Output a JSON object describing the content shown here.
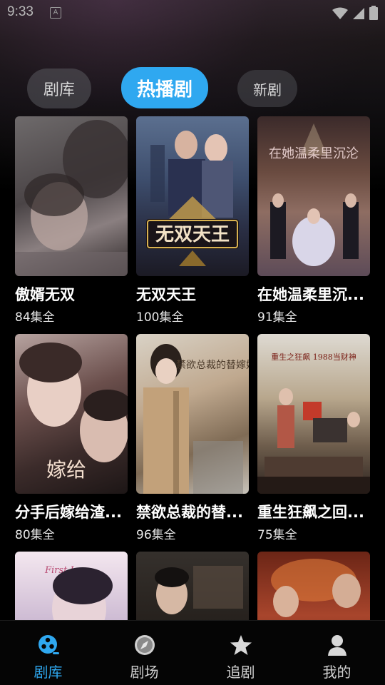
{
  "status_bar": {
    "time": "9:33",
    "notification_icon": "A"
  },
  "tabs": [
    {
      "label": "剧库"
    },
    {
      "label": "热播剧"
    },
    {
      "label": "新剧"
    }
  ],
  "dramas": [
    {
      "title": "傲婿无双",
      "episodes": "84集全"
    },
    {
      "title": "无双天王",
      "episodes": "100集全"
    },
    {
      "title": "在她温柔里沉...",
      "episodes": "91集全"
    },
    {
      "title": "分手后嫁给渣...",
      "episodes": "80集全"
    },
    {
      "title": "禁欲总裁的替...",
      "episodes": "96集全"
    },
    {
      "title": "重生狂飙之回...",
      "episodes": "75集全"
    },
    {
      "title": "",
      "episodes": ""
    },
    {
      "title": "",
      "episodes": ""
    },
    {
      "title": "",
      "episodes": ""
    }
  ],
  "poster_text": {
    "p2": "无双天王",
    "p3": "在她温柔里沉沦",
    "p4": "嫁给",
    "p5": "禁欲总裁的替嫁娇",
    "p6": "重生之狂飙 1988当财神",
    "p7": "First Love"
  },
  "bottom_nav": [
    {
      "label": "剧库",
      "icon": "film-reel-icon",
      "active": true
    },
    {
      "label": "剧场",
      "icon": "compass-icon",
      "active": false
    },
    {
      "label": "追剧",
      "icon": "star-icon",
      "active": false
    },
    {
      "label": "我的",
      "icon": "user-icon",
      "active": false
    }
  ],
  "colors": {
    "accent": "#2fa8f0",
    "background": "#000000"
  }
}
